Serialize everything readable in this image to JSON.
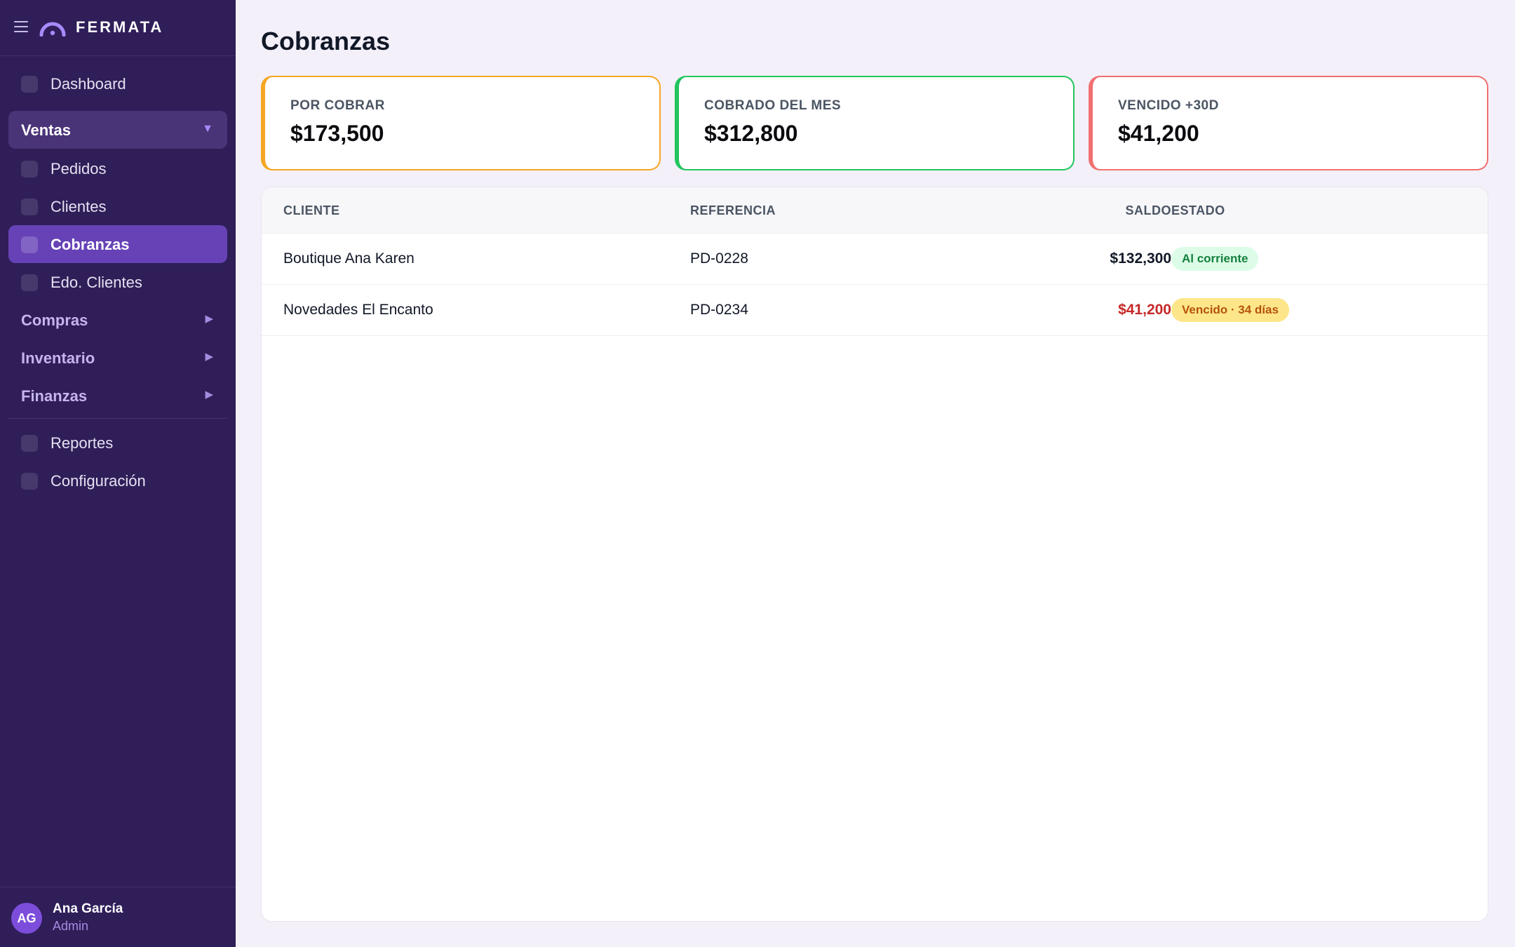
{
  "app": {
    "brand": "FERMATA"
  },
  "sidebar": {
    "dashboard": "Dashboard",
    "ventas": {
      "label": "Ventas",
      "arrow": "▼"
    },
    "ventas_items": {
      "pedidos": "Pedidos",
      "clientes": "Clientes",
      "cobranzas": "Cobranzas",
      "edo_clientes": "Edo. Clientes"
    },
    "compras": {
      "label": "Compras",
      "arrow": "▶"
    },
    "inventario": {
      "label": "Inventario",
      "arrow": "▶"
    },
    "finanzas": {
      "label": "Finanzas",
      "arrow": "▶"
    },
    "reportes": "Reportes",
    "configuracion": "Configuración"
  },
  "user": {
    "initials": "AG",
    "name": "Ana García",
    "role": "Admin"
  },
  "page": {
    "title": "Cobranzas"
  },
  "stats": [
    {
      "label": "POR COBRAR",
      "value": "$173,500",
      "color": "#f5a623"
    },
    {
      "label": "COBRADO DEL MES",
      "value": "$312,800",
      "color": "#22c55e"
    },
    {
      "label": "VENCIDO +30D",
      "value": "$41,200",
      "color": "#f07070"
    }
  ],
  "table": {
    "headers": {
      "cliente": "CLIENTE",
      "referencia": "REFERENCIA",
      "saldo": "SALDO",
      "estado": "ESTADO"
    },
    "rows": [
      {
        "cliente": "Boutique Ana Karen",
        "referencia": "PD-0228",
        "saldo": "$132,300",
        "estado": "Al corriente",
        "saldo_color": "#111827"
      },
      {
        "cliente": "Novedades El Encanto",
        "referencia": "PD-0234",
        "saldo": "$41,200",
        "estado": "Vencido · 34 días",
        "saldo_color": "#c62828"
      }
    ]
  },
  "colors": {
    "sidebar_bg": "#2f1e58",
    "accent": "#6642b6",
    "background": "#f4f0fa"
  }
}
